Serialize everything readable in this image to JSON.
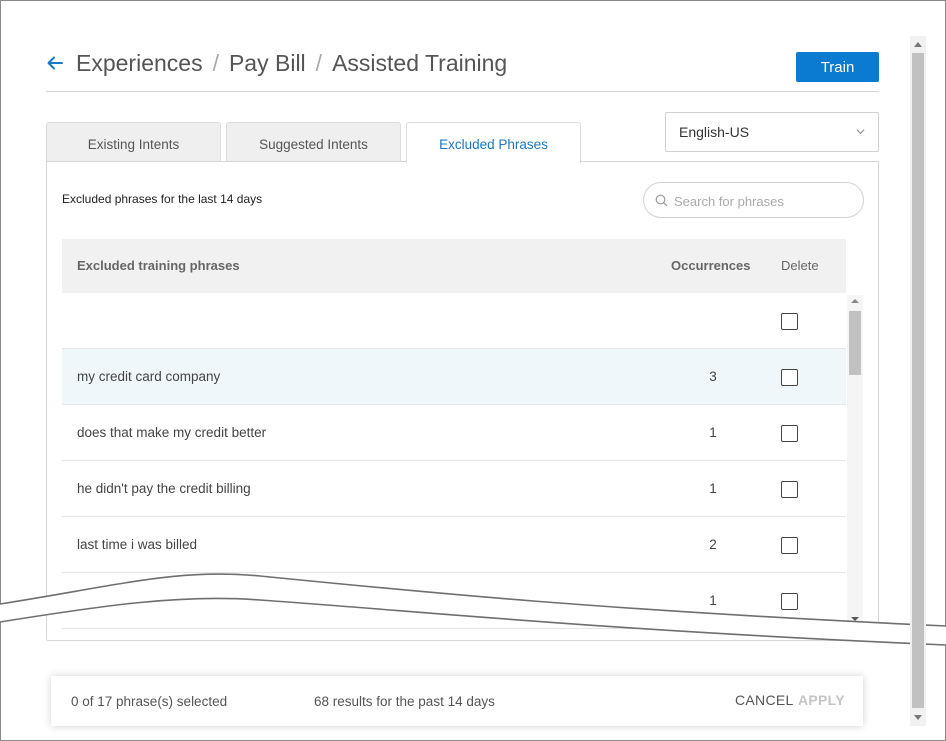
{
  "header": {
    "breadcrumb": [
      "Experiences",
      "Pay Bill",
      "Assisted Training"
    ],
    "separator": "/",
    "train_label": "Train"
  },
  "language": {
    "selected": "English-US"
  },
  "tabs": [
    {
      "label": "Existing Intents",
      "active": false
    },
    {
      "label": "Suggested Intents",
      "active": false
    },
    {
      "label": "Excluded Phrases",
      "active": true
    }
  ],
  "panel": {
    "caption": "Excluded phrases for the last 14 days",
    "search_placeholder": "Search for phrases"
  },
  "table": {
    "columns": [
      "Excluded training phrases",
      "Occurrences",
      "Delete"
    ],
    "rows": [
      {
        "phrase": "",
        "occurrences": "",
        "checked": false
      },
      {
        "phrase": "my credit card company",
        "occurrences": "3",
        "checked": false
      },
      {
        "phrase": "does that make my credit better",
        "occurrences": "1",
        "checked": false
      },
      {
        "phrase": "he didn't pay the credit billing",
        "occurrences": "1",
        "checked": false
      },
      {
        "phrase": "last time i was billed",
        "occurrences": "2",
        "checked": false
      },
      {
        "phrase": "",
        "occurrences": "1",
        "checked": false
      }
    ]
  },
  "footer": {
    "selected_text": "0 of 17 phrase(s) selected",
    "results_text": "68 results for the past 14 days",
    "cancel_label": "CANCEL",
    "apply_label": "APPLY"
  },
  "colors": {
    "accent": "#0a7bd0",
    "active_tab_text": "#1a78c2",
    "highlight_row": "#f0f7fb",
    "apply_disabled": "#c4c4c4"
  }
}
